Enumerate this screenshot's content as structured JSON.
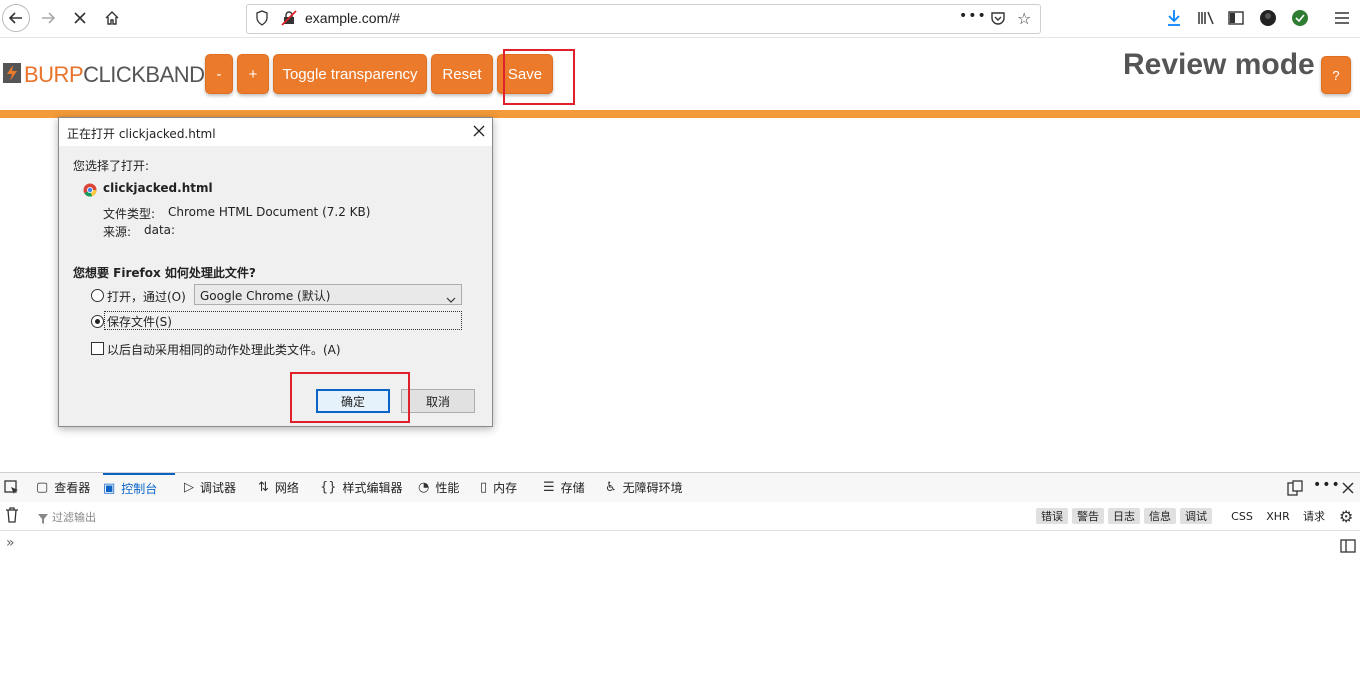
{
  "browser": {
    "url": "example.com/#",
    "icons": {
      "back": "back-arrow-icon",
      "forward": "forward-arrow-icon",
      "stop": "stop-icon",
      "home": "home-icon"
    }
  },
  "burp": {
    "logo_burp": "BURP",
    "logo_clickbandit": "CLICKBANDIT",
    "buttons": [
      "-",
      "+",
      "Toggle transparency",
      "Reset",
      "Save"
    ],
    "mode_title": "Review mode",
    "help_label": "?",
    "accent": "#ec7a2b"
  },
  "dialog": {
    "title": "正在打开 clickjacked.html",
    "chosen_label": "您选择了打开:",
    "filename": "clickjacked.html",
    "type_label": "文件类型:",
    "type_value": "Chrome HTML Document (7.2 KB)",
    "source_label": "来源:",
    "source_value": "data:",
    "question": "您想要 Firefox 如何处理此文件?",
    "open_with_label": "打开，通过(O)",
    "open_with_app": "Google Chrome (默认)",
    "save_file_label": "保存文件(S)",
    "auto_label": "以后自动采用相同的动作处理此类文件。(A)",
    "ok_label": "确定",
    "cancel_label": "取消"
  },
  "devtools": {
    "tabs": [
      "查看器",
      "控制台",
      "调试器",
      "网络",
      "样式编辑器",
      "性能",
      "内存",
      "存储",
      "无障碍环境"
    ],
    "active_tab": "控制台",
    "filter_placeholder": "过滤输出",
    "levels": [
      "错误",
      "警告",
      "日志",
      "信息",
      "调试"
    ],
    "types": [
      "CSS",
      "XHR",
      "请求"
    ]
  }
}
